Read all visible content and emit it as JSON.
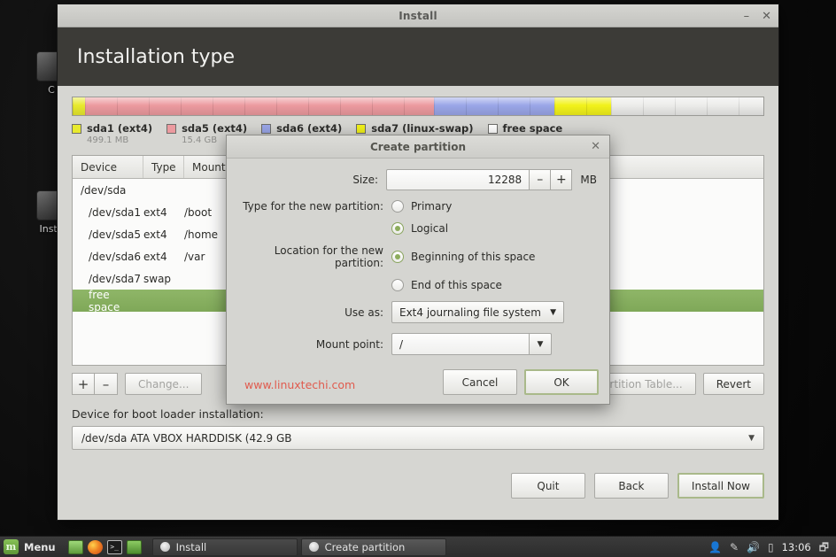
{
  "desktop": {
    "icons": [
      {
        "name": "Computer",
        "label": "C"
      },
      {
        "name": "Install Linux Mint",
        "label": "Insta"
      }
    ]
  },
  "window": {
    "title": "Install",
    "minimize_glyph": "–",
    "close_glyph": "✕",
    "header_title": "Installation type"
  },
  "partition_bar": {
    "segments": [
      {
        "name": "sda1",
        "color": "#e8ea2e",
        "percent": 1.8
      },
      {
        "name": "sda5",
        "color": "#ec9a9f",
        "percent": 50.5
      },
      {
        "name": "sda6",
        "color": "#9aa6e8",
        "percent": 17.5
      },
      {
        "name": "sda7",
        "color": "#f2f21a",
        "percent": 8.2
      },
      {
        "name": "free space",
        "color": "#ececea",
        "percent": 22.0
      }
    ]
  },
  "legend": [
    {
      "label": "sda1 (ext4)",
      "size": "499.1 MB",
      "color": "#e8ea2e"
    },
    {
      "label": "sda5 (ext4)",
      "size": "15.4 GB",
      "color": "#ec9a9f"
    },
    {
      "label": "sda6 (ext4)",
      "size": "",
      "color": "#9aa6e8"
    },
    {
      "label": "sda7 (linux-swap)",
      "size": "",
      "color": "#f2f21a"
    },
    {
      "label": "free space",
      "size": "",
      "color": "#ffffff"
    }
  ],
  "table": {
    "headers": {
      "device": "Device",
      "type": "Type",
      "mount_point": "Mount p",
      "size": ""
    },
    "rows": [
      {
        "device": "/dev/sda",
        "type": "",
        "mount": "",
        "disk": true,
        "selected": false
      },
      {
        "device": "/dev/sda1",
        "type": "ext4",
        "mount": "/boot",
        "disk": false,
        "selected": false
      },
      {
        "device": "/dev/sda5",
        "type": "ext4",
        "mount": "/home",
        "disk": false,
        "selected": false
      },
      {
        "device": "/dev/sda6",
        "type": "ext4",
        "mount": "/var",
        "disk": false,
        "selected": false
      },
      {
        "device": "/dev/sda7",
        "type": "swap",
        "mount": "",
        "disk": false,
        "selected": false
      },
      {
        "device": "free space",
        "type": "",
        "mount": "",
        "disk": false,
        "selected": true
      }
    ]
  },
  "table_buttons": {
    "add": "+",
    "remove": "–",
    "change": "Change...",
    "new_partition_table": "Partition Table...",
    "revert": "Revert"
  },
  "bootloader": {
    "label": "Device for boot loader installation:",
    "value": "/dev/sda   ATA VBOX HARDDISK (42.9 GB",
    "caret": "▼"
  },
  "footer": {
    "quit": "Quit",
    "back": "Back",
    "install_now": "Install Now"
  },
  "dialog": {
    "title": "Create partition",
    "close_glyph": "✕",
    "size_label": "Size:",
    "size_value": "12288",
    "size_unit": "MB",
    "minus": "–",
    "plus": "+",
    "type_label": "Type for the new partition:",
    "type_options": [
      {
        "label": "Primary",
        "selected": false
      },
      {
        "label": "Logical",
        "selected": true
      }
    ],
    "location_label": "Location for the new partition:",
    "location_options": [
      {
        "label": "Beginning of this space",
        "selected": true
      },
      {
        "label": "End of this space",
        "selected": false
      }
    ],
    "use_as_label": "Use as:",
    "use_as_value": "Ext4 journaling file system",
    "mount_point_label": "Mount point:",
    "mount_point_value": "/",
    "caret": "▼",
    "cancel": "Cancel",
    "ok": "OK",
    "watermark": "www.linuxtechi.com",
    "watermark_color": "#e05b4e"
  },
  "taskbar": {
    "menu_label": "Menu",
    "mint_logo_glyph": "m",
    "launchers": [
      {
        "name": "show-desktop"
      },
      {
        "name": "firefox"
      },
      {
        "name": "terminal",
        "glyph": ">_"
      },
      {
        "name": "file-manager"
      }
    ],
    "tasks": [
      {
        "label": "Install",
        "active": false
      },
      {
        "label": "Create partition",
        "active": true
      }
    ],
    "tray": {
      "user_icon": "👤",
      "update_icon": "✎",
      "volume_icon": "🔊",
      "battery_icon": "▯",
      "clock": "13:06",
      "windows_icon": "🗗"
    }
  }
}
